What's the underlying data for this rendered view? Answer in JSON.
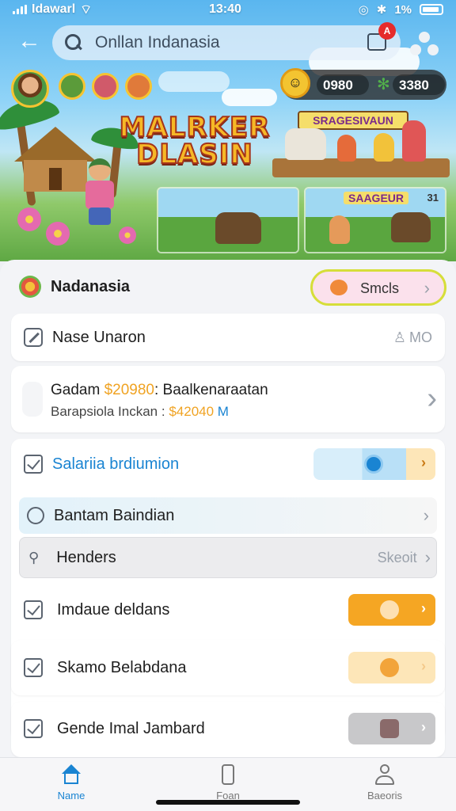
{
  "status_bar": {
    "carrier": "Idawarl",
    "time": "13:40",
    "battery_text": "1%"
  },
  "top_bar": {
    "search_text": "Onllan Indanasia",
    "notification_badge": "A"
  },
  "hero": {
    "currency_1": "0980",
    "currency_2": "3380",
    "game_title_line1": "MALRKER",
    "game_title_line2": "DLASIN",
    "banner_text": "SRAGESIVAUN",
    "thumb_label": "SAAGEUR",
    "thumb_label_number": "31"
  },
  "list": {
    "header_title": "Nadanasia",
    "header_button": "Smcls",
    "row1_label": "Nase Unaron",
    "row1_meta": "MO",
    "info_line1_prefix": "Gadam",
    "info_line1_value": "$20980",
    "info_line1_suffix": ": Baalkenaraatan",
    "info_line2_prefix": "Barapsiola Inckan :",
    "info_line2_value": "$42040",
    "info_line2_suffix": "M",
    "row2_label": "Salariia brdiumion",
    "row3_label": "Bantam Baindian",
    "row4_label": "Henders",
    "row4_meta": "Skeoit",
    "row5_label": "Imdaue deldans",
    "row6_label": "Skamo Belabdana",
    "row7_label": "Gende Imal Jambard"
  },
  "bottom_nav": {
    "item1": "Name",
    "item2": "Foan",
    "item3": "Baeoris"
  },
  "colors": {
    "accent_blue": "#1a84d2",
    "orange": "#f5a623",
    "toggle_light_orange": "#fde6b8",
    "toggle_grey": "#c8c8ca",
    "pink_button": "#fbe1ec",
    "highlight_ring": "#d6de3a"
  }
}
